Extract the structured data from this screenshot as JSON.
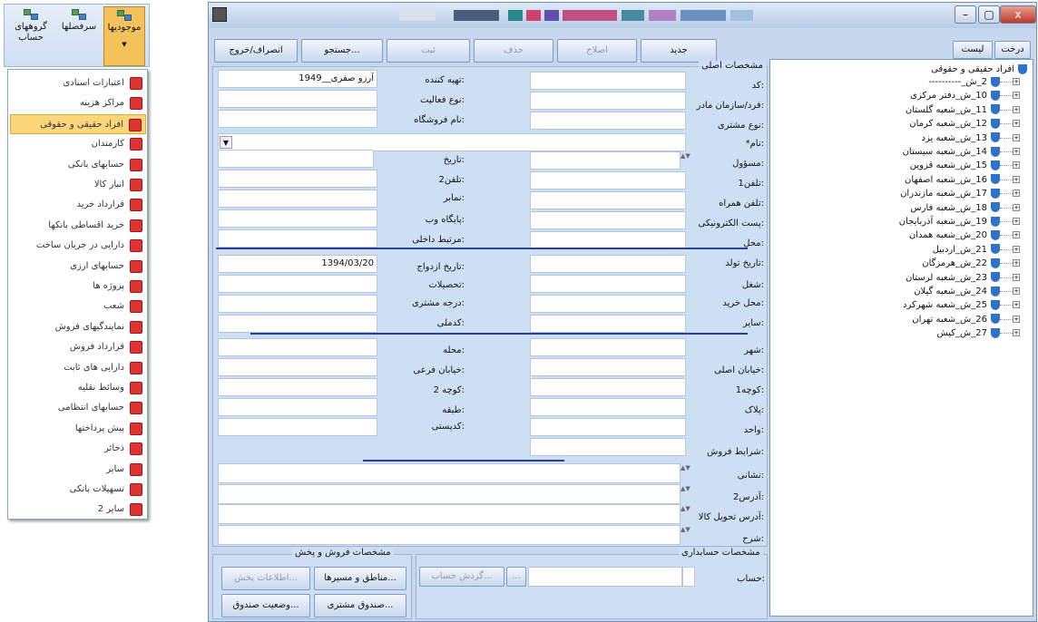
{
  "ribbon": {
    "assets_label": "موجودیها",
    "headings_label": "سرفصلها",
    "account_groups_label": "گروههای حساب"
  },
  "menu": {
    "items": [
      {
        "label": "اعتبارات اسنادی"
      },
      {
        "label": "مراکز هزینه"
      },
      {
        "label": "افراد حقیقی و حقوقی"
      },
      {
        "label": "کارمندان"
      },
      {
        "label": "حسابهای بانکی"
      },
      {
        "label": "انبار کالا"
      },
      {
        "label": "قرارداد خرید"
      },
      {
        "label": "خرید اقساطی بانکها"
      },
      {
        "label": "دارایی در جریان ساخت"
      },
      {
        "label": "حسابهای ارزی"
      },
      {
        "label": "پروژه ها"
      },
      {
        "label": "شعب"
      },
      {
        "label": "نمایندگیهای فروش"
      },
      {
        "label": "قرارداد فروش"
      },
      {
        "label": "دارایی های ثابت"
      },
      {
        "label": "وسائط نقلیه"
      },
      {
        "label": "حسابهای انتظامی"
      },
      {
        "label": "پیش پرداختها"
      },
      {
        "label": "ذخائر"
      },
      {
        "label": "سایر"
      },
      {
        "label": "تسهیلات بانکی"
      },
      {
        "label": "سایر 2"
      }
    ],
    "selected_index": 2
  },
  "window": {
    "close_glyph": "x",
    "minimize_glyph": "–",
    "maximize_glyph": "▢"
  },
  "toolbar": {
    "new": "جدید",
    "edit": "اصلاح",
    "delete": "حذف",
    "save": "ثبت",
    "search": "جستجو...",
    "exit": "انصراف/خروج"
  },
  "tree_toolbar": {
    "tree": "درخت",
    "list": "لیست"
  },
  "tree": {
    "root": "افراد حقیقی و حقوقی",
    "nodes": [
      "2_ش_----------",
      "10_ش_دفتر مرکزی",
      "11_ش_شعبه گلستان",
      "12_ش_شعبه کرمان",
      "13_ش_شعبه یزد",
      "14_ش_شعبه سیستان",
      "15_ش_شعبه قزوین",
      "16_ش_شعبه اصفهان",
      "17_ش_شعبه مازندران",
      "18_ش_شعبه فارس",
      "19_ش_شعبه آذربایجان",
      "20_ش_شعبه همدان",
      "21_ش_اردبیل",
      "22_ش_هرمزگان",
      "23_ش_شعبه لرستان",
      "24_ش_شعبه گیلان",
      "25_ش_شعبه شهرکرد",
      "26_ش_شعبه تهران",
      "27_ش_کیش"
    ]
  },
  "form": {
    "section_title": "مشخصات اصلی",
    "labels": {
      "code": ":کد",
      "parent": ":فرد/سازمان مادر",
      "customer_type": ":نوع مشتری",
      "name": ":نام*",
      "responsible": ":مسؤول",
      "phone1": ":تلفن1",
      "mobile": ":تلفن همراه",
      "email": ":پست الکترونیکی",
      "place": ":محل",
      "preparer": ":تهیه کننده",
      "activity": ":نوع فعالیت",
      "store_name": ":نام فروشگاه",
      "date": ":تاریخ",
      "phone2": ":تلفن2",
      "fax": ":نمابر",
      "website": ":پایگاه وب",
      "extension": ":مرتبط داخلی",
      "birth_date": ":تاریخ تولد",
      "job": ":شغل",
      "purchase_place": ":محل خرید",
      "other": ":سایر",
      "marriage_date": ":تاریخ ازدواج",
      "education": ":تحصیلات",
      "customer_grade": ":درجه مشتری",
      "national_code": ":کدملی",
      "city": ":شهر",
      "main_street": ":خیابان اصلی",
      "alley1": ":کوچه1",
      "plate": ":پلاک",
      "unit": ":واحد",
      "sale_terms": ":شرایط فروش",
      "district": ":محله",
      "side_street": ":خیابان فرعی",
      "alley2": ":کوچه 2",
      "floor": ":طبقه",
      "postal_code": ":کدپستی",
      "address": ":نشانی",
      "address2": ":آدرس2",
      "delivery_address": ":آدرس تحویل کالا",
      "description": ":شرح"
    },
    "values": {
      "preparer": "آرزو صفری__1949",
      "marriage_date": "1394/03/20"
    }
  },
  "sales_panel": {
    "title": "مشخصات فروش و پخش",
    "regions": "مناطق و مسیرها...",
    "dist_info": "اطلاعات پخش...",
    "customer_box": "صندوق مشتری...",
    "box_status": "وضعیت صندوق..."
  },
  "accounting_panel": {
    "title": "مشخصات حسابداری",
    "account_label": ":حساب",
    "browse": "...",
    "turnover": "گردش حساب..."
  },
  "colors": {
    "window_bg": "#c7d8ee",
    "selected_menu": "#fbd67a",
    "separator": "#2a3fa0"
  }
}
